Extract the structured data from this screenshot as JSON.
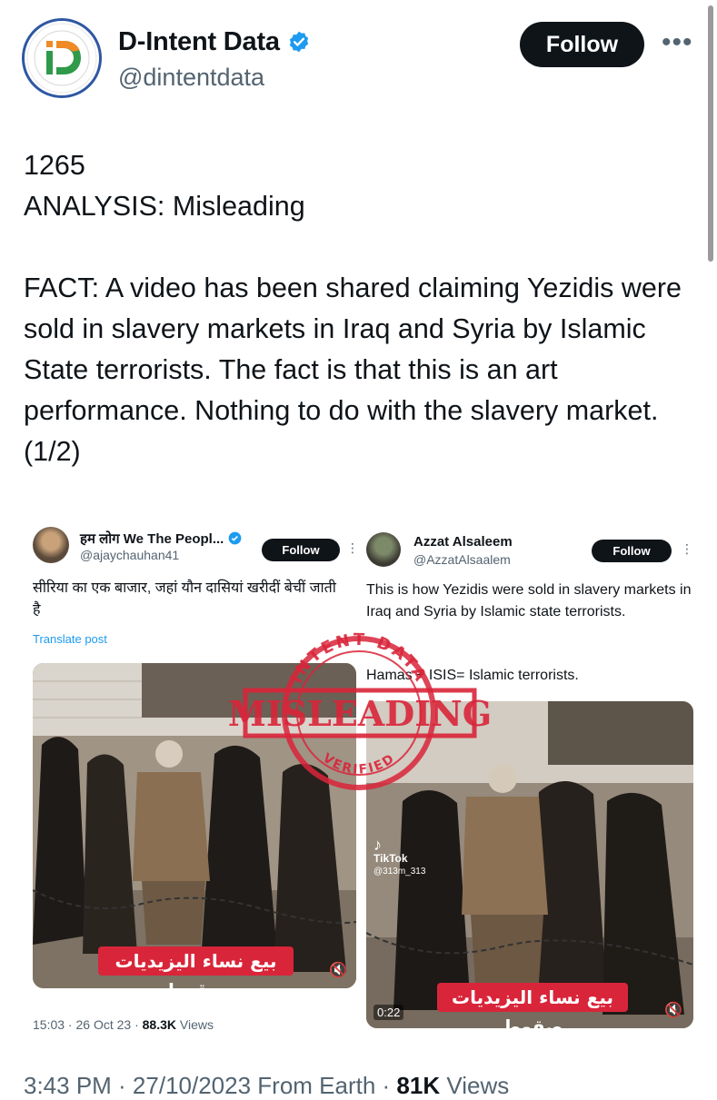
{
  "profile": {
    "name": "D-Intent Data",
    "handle": "@dintentdata",
    "follow_label": "Follow",
    "more_icon": "•••",
    "logo_text": "iD"
  },
  "tweet": {
    "line1": "1265",
    "line2": "ANALYSIS: Misleading",
    "body": "FACT: A video has been shared claiming Yezidis were sold in slavery markets in Iraq and Syria by Islamic State terrorists. The fact is that this is an art performance. Nothing to do with the slavery market. (1/2)"
  },
  "left_post": {
    "name": "हम लोग We The Peopl...",
    "handle": "@ajaychauhan41",
    "follow_label": "Follow",
    "text": "सीरिया का एक बाजार, जहां यौन दासियां खरीदीं बेचीं जाती है",
    "translate": "Translate post",
    "caption": "بيع نساء اليزيديات صقوط",
    "time": "15:03 · 26 Oct 23 · ",
    "views_count": "88.3K",
    "views_label": " Views"
  },
  "right_post": {
    "name": "Azzat Alsaleem",
    "handle": "@AzzatAlsaalem",
    "follow_label": "Follow",
    "text": "This is how Yezidis were sold in slavery markets in Iraq and Syria by Islamic state terrorists.",
    "text2": "Hamas + ISIS= Islamic terrorists.",
    "caption": "بيع نساء اليزيديات صقوط",
    "tiktok_label": "TikTok",
    "tiktok_user": "@313m_313",
    "duration": "0:22"
  },
  "stamp": {
    "top_text": "INTENT DATA",
    "main_text": "MISLEADING",
    "bottom_text": "VERIFIED",
    "color": "#d9253a"
  },
  "footer": {
    "time": "3:43 PM · 27/10/2023 From Earth · ",
    "views_count": "81K",
    "views_label": " Views"
  },
  "colors": {
    "text": "#0f1419",
    "secondary": "#536471",
    "link": "#1d9bf0",
    "verified": "#1d9bf0"
  }
}
